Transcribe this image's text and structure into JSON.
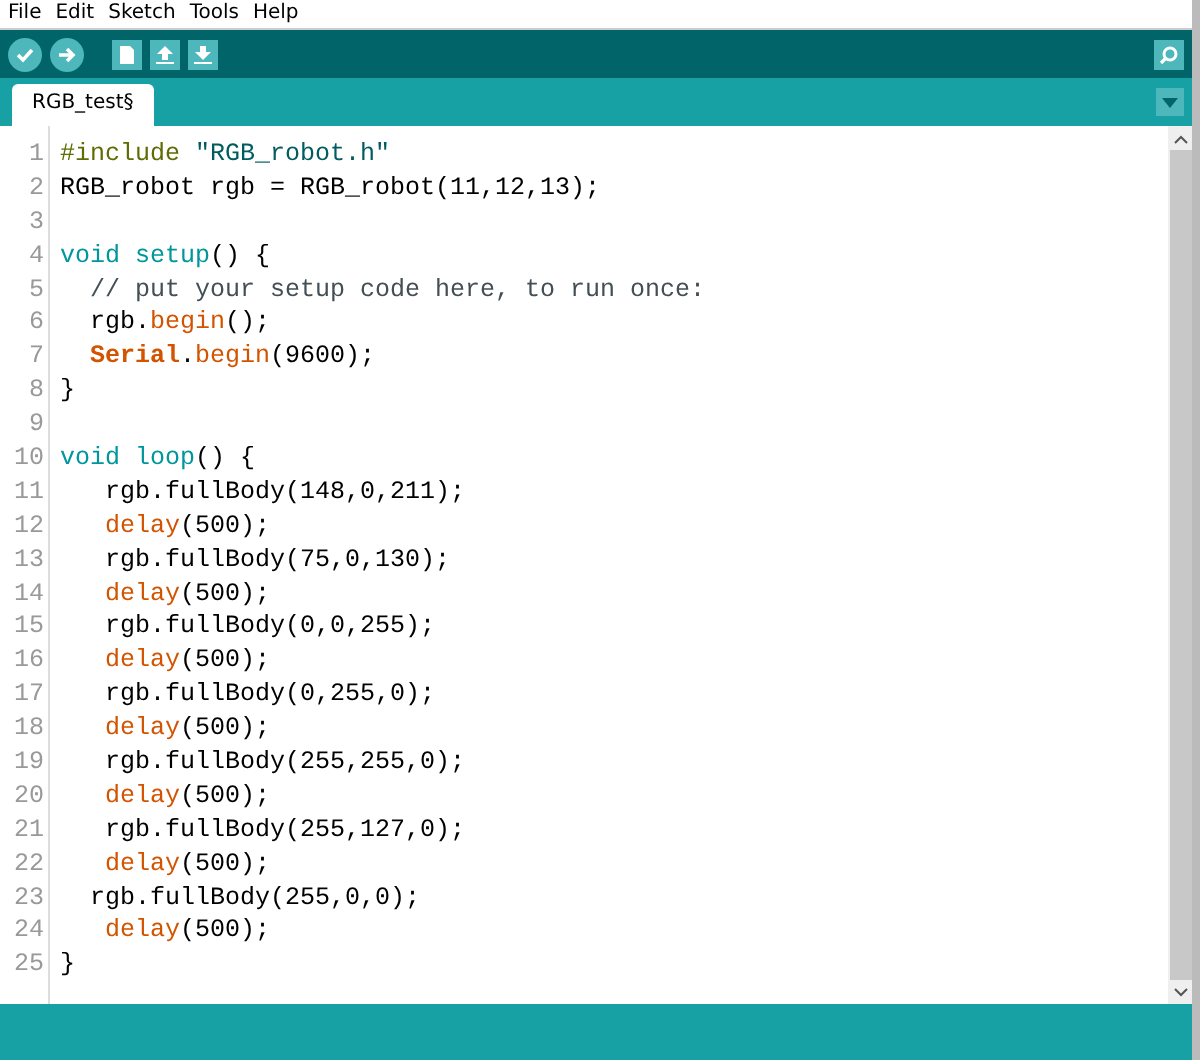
{
  "menu": [
    "File",
    "Edit",
    "Sketch",
    "Tools",
    "Help"
  ],
  "tabs": [
    {
      "label": "RGB_test§",
      "selected": true
    }
  ],
  "code": [
    {
      "n": "1",
      "tokens": [
        {
          "t": "#include",
          "kind": "directive"
        },
        {
          "t": " \"RGB_robot.h\"",
          "kind": "string"
        }
      ]
    },
    {
      "n": "2",
      "tokens": [
        {
          "t": "RGB_robot rgb = RGB_robot(11,12,13);",
          "kind": "plain"
        }
      ]
    },
    {
      "n": "3"
    },
    {
      "n": "4",
      "tokens": [
        {
          "t": "void",
          "kind": "keyword"
        },
        {
          "t": " setup",
          "kind": "keyword"
        },
        {
          "t": "() {",
          "kind": "plain"
        }
      ]
    },
    {
      "n": "5",
      "tokens": [
        {
          "t": "  // put your setup code here, to run once:",
          "kind": "comment"
        }
      ]
    },
    {
      "n": "6",
      "tokens": [
        {
          "t": "  rgb.",
          "kind": "plain"
        },
        {
          "t": "begin",
          "kind": "function"
        },
        {
          "t": "();",
          "kind": "plain"
        }
      ]
    },
    {
      "n": "7",
      "tokens": [
        {
          "t": "  Serial",
          "kind": "class"
        },
        {
          "t": ".",
          "kind": "plain"
        },
        {
          "t": "begin",
          "kind": "function"
        },
        {
          "t": "(9600);",
          "kind": "plain"
        }
      ]
    },
    {
      "n": "8",
      "tokens": [
        {
          "t": "}",
          "kind": "plain"
        }
      ]
    },
    {
      "n": "9"
    },
    {
      "n": "10",
      "tokens": [
        {
          "t": "void",
          "kind": "keyword"
        },
        {
          "t": " loop",
          "kind": "keyword"
        },
        {
          "t": "() {",
          "kind": "plain"
        }
      ]
    },
    {
      "n": "11",
      "tokens": [
        {
          "t": "   rgb.fullBody(148,0,211);",
          "kind": "plain"
        }
      ]
    },
    {
      "n": "12",
      "tokens": [
        {
          "t": "   delay",
          "kind": "function"
        },
        {
          "t": "(500);",
          "kind": "plain"
        }
      ]
    },
    {
      "n": "13",
      "tokens": [
        {
          "t": "   rgb.fullBody(75,0,130);",
          "kind": "plain"
        }
      ]
    },
    {
      "n": "14",
      "tokens": [
        {
          "t": "   delay",
          "kind": "function"
        },
        {
          "t": "(500);",
          "kind": "plain"
        }
      ]
    },
    {
      "n": "15",
      "tokens": [
        {
          "t": "   rgb.fullBody(0,0,255);",
          "kind": "plain"
        }
      ]
    },
    {
      "n": "16",
      "tokens": [
        {
          "t": "   delay",
          "kind": "function"
        },
        {
          "t": "(500);",
          "kind": "plain"
        }
      ]
    },
    {
      "n": "17",
      "tokens": [
        {
          "t": "   rgb.fullBody(0,255,0);",
          "kind": "plain"
        }
      ]
    },
    {
      "n": "18",
      "tokens": [
        {
          "t": "   delay",
          "kind": "function"
        },
        {
          "t": "(500);",
          "kind": "plain"
        }
      ]
    },
    {
      "n": "19",
      "tokens": [
        {
          "t": "   rgb.fullBody(255,255,0);",
          "kind": "plain"
        }
      ]
    },
    {
      "n": "20",
      "tokens": [
        {
          "t": "   delay",
          "kind": "function"
        },
        {
          "t": "(500);",
          "kind": "plain"
        }
      ]
    },
    {
      "n": "21",
      "tokens": [
        {
          "t": "   rgb.fullBody(255,127,0);",
          "kind": "plain"
        }
      ]
    },
    {
      "n": "22",
      "tokens": [
        {
          "t": "   delay",
          "kind": "function"
        },
        {
          "t": "(500);",
          "kind": "plain"
        }
      ]
    },
    {
      "n": "23",
      "tokens": [
        {
          "t": "  rgb.fullBody(255,0,0);",
          "kind": "plain"
        }
      ]
    },
    {
      "n": "24",
      "tokens": [
        {
          "t": "   delay",
          "kind": "function"
        },
        {
          "t": "(500);",
          "kind": "plain"
        }
      ]
    },
    {
      "n": "25",
      "tokens": [
        {
          "t": "}",
          "kind": "plain"
        }
      ]
    }
  ]
}
